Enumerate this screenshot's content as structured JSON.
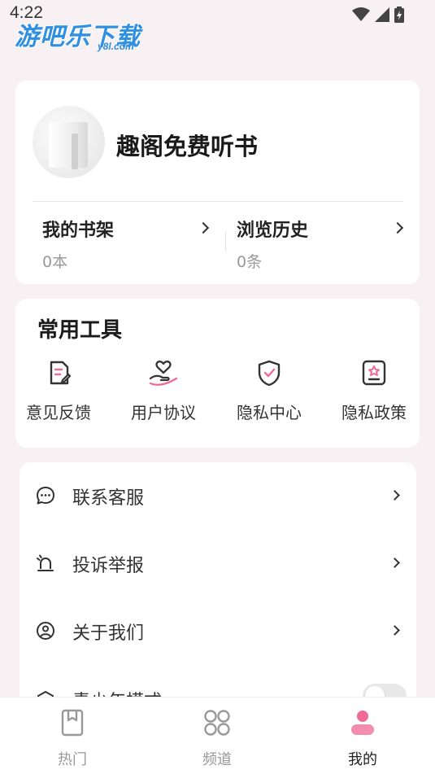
{
  "status_bar": {
    "time": "4:22"
  },
  "watermark": {
    "text": "游吧乐下载",
    "sub": "y8l.com"
  },
  "profile": {
    "app_name": "趣阁免费听书",
    "shelf": {
      "label": "我的书架",
      "value": "0本"
    },
    "history": {
      "label": "浏览历史",
      "value": "0条"
    }
  },
  "tools": {
    "title": "常用工具",
    "items": [
      {
        "label": "意见反馈",
        "icon": "feedback-icon"
      },
      {
        "label": "用户协议",
        "icon": "user-agreement-icon"
      },
      {
        "label": "隐私中心",
        "icon": "privacy-center-icon"
      },
      {
        "label": "隐私政策",
        "icon": "privacy-policy-icon"
      }
    ]
  },
  "menu": {
    "items": [
      {
        "label": "联系客服",
        "icon": "chat-icon"
      },
      {
        "label": "投诉举报",
        "icon": "alarm-icon"
      },
      {
        "label": "关于我们",
        "icon": "about-icon"
      },
      {
        "label": "青少年模式",
        "icon": "teen-mode-icon",
        "toggle": false
      }
    ]
  },
  "bottom_nav": {
    "items": [
      {
        "label": "热门",
        "icon": "bookmark-icon",
        "active": false
      },
      {
        "label": "频道",
        "icon": "grid-icon",
        "active": false
      },
      {
        "label": "我的",
        "icon": "person-icon",
        "active": true
      }
    ]
  },
  "colors": {
    "accent": "#f06a97",
    "background": "#f7f1f3",
    "icon_stroke": "#333333"
  }
}
